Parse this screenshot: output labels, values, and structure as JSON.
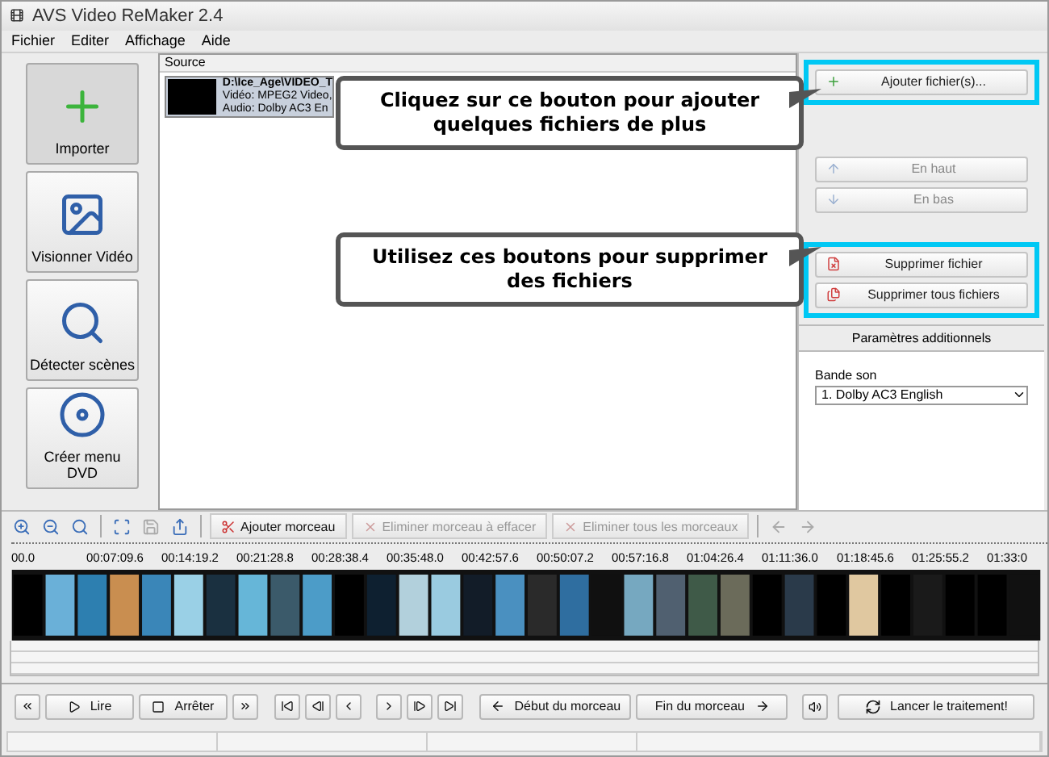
{
  "window": {
    "title": "AVS Video ReMaker 2.4"
  },
  "menu": [
    "Fichier",
    "Editer",
    "Affichage",
    "Aide"
  ],
  "sidebar": [
    {
      "label": "Importer",
      "selected": true
    },
    {
      "label": "Visionner Vidéo",
      "selected": false
    },
    {
      "label": "Détecter scènes",
      "selected": false
    },
    {
      "label": "Créer menu DVD",
      "selected": false
    }
  ],
  "source": {
    "header": "Source",
    "files": [
      {
        "path": "D:\\Ice_Age\\VIDEO_T",
        "video": "Vidéo: MPEG2 Video,",
        "audio": "Audio: Dolby AC3 En",
        "selected": true
      }
    ]
  },
  "callouts": [
    {
      "text": "Cliquez sur ce bouton pour ajouter quelques fichiers de plus"
    },
    {
      "text": "Utilisez ces boutons pour supprimer des fichiers"
    }
  ],
  "button_groups": [
    {
      "highlighted": true,
      "buttons": [
        {
          "label": "Ajouter fichier(s)...",
          "disabled": false
        }
      ]
    },
    {
      "highlighted": false,
      "buttons": [
        {
          "label": "En haut",
          "disabled": true
        },
        {
          "label": "En bas",
          "disabled": true
        }
      ]
    },
    {
      "highlighted": true,
      "buttons": [
        {
          "label": "Supprimer fichier",
          "disabled": false
        },
        {
          "label": "Supprimer tous fichiers",
          "disabled": false
        }
      ]
    }
  ],
  "additional": {
    "title": "Paramètres additionnels",
    "audio_label": "Bande son",
    "audio_value": "1. Dolby AC3 English"
  },
  "toolbar": [
    {
      "label": "Ajouter morceau",
      "disabled": false
    },
    {
      "label": "Eliminer morceau à effacer",
      "disabled": true
    },
    {
      "label": "Eliminer tous les morceaux",
      "disabled": true
    }
  ],
  "timeline": {
    "ticks": [
      "00.0",
      "00:07:09.6",
      "00:14:19.2",
      "00:21:28.8",
      "00:28:38.4",
      "00:35:48.0",
      "00:42:57.6",
      "00:50:07.2",
      "00:57:16.8",
      "01:04:26.4",
      "01:11:36.0",
      "01:18:45.6",
      "01:25:55.2",
      "01:33:0"
    ]
  },
  "transport": {
    "play": "Lire",
    "stop": "Arrêter",
    "start_mark": "Début du morceau",
    "end_mark": "Fin du morceau",
    "process": "Lancer le traitement!"
  }
}
